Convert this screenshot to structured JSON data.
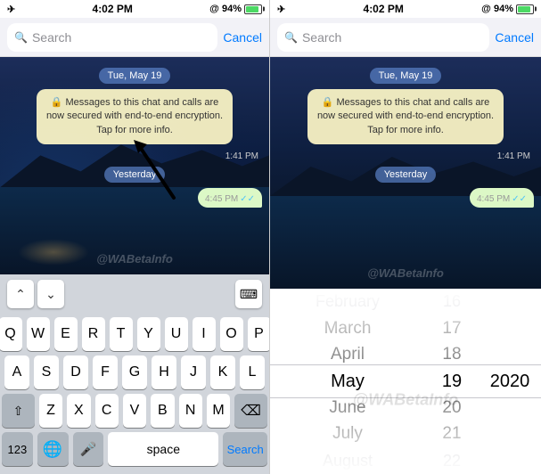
{
  "panels": [
    {
      "id": "left",
      "statusBar": {
        "airplane": "✈",
        "time": "4:02 PM",
        "signal": "@ 94%"
      },
      "searchBar": {
        "placeholder": "Search",
        "cancelLabel": "Cancel"
      },
      "chat": {
        "dateBadge": "Tue, May 19",
        "systemMsg": "Messages to this chat and calls are now secured with end-to-end encryption. Tap for more info.",
        "lockIcon": "🔒",
        "time1": "1:41 PM",
        "yesterdayBadge": "Yesterday",
        "time2": "4:45 PM"
      },
      "keyboard": {
        "row1": [
          "Q",
          "W",
          "E",
          "R",
          "T",
          "Y",
          "U",
          "I",
          "O",
          "P"
        ],
        "row2": [
          "A",
          "S",
          "D",
          "F",
          "G",
          "H",
          "J",
          "K",
          "L"
        ],
        "row3": [
          "Z",
          "X",
          "C",
          "V",
          "B",
          "N",
          "M"
        ],
        "spaceLabel": "space",
        "searchLabel": "Search",
        "numLabel": "123",
        "deleteLabel": "⌫",
        "shiftLabel": "⇧",
        "globeLabel": "🌐",
        "micLabel": "🎤"
      }
    },
    {
      "id": "right",
      "statusBar": {
        "airplane": "✈",
        "time": "4:02 PM",
        "signal": "@ 94%"
      },
      "searchBar": {
        "placeholder": "Search",
        "cancelLabel": "Cancel"
      },
      "chat": {
        "dateBadge": "Tue, May 19",
        "systemMsg": "Messages to this chat and calls are now secured with end-to-end encryption. Tap for more info.",
        "lockIcon": "🔒",
        "time1": "1:41 PM",
        "yesterdayBadge": "Yesterday",
        "time2": "4:45 PM"
      },
      "datePicker": {
        "months": [
          "February",
          "March",
          "April",
          "May",
          "June",
          "July",
          "August"
        ],
        "days": [
          "16",
          "17",
          "18",
          "19",
          "20",
          "21",
          "22"
        ],
        "years": [
          "",
          "",
          "",
          "2020",
          "",
          "",
          ""
        ],
        "selectedMonth": "May",
        "selectedDay": "19",
        "selectedYear": "2020"
      }
    }
  ],
  "watermark": "@WABetaInfo",
  "watermark2": "@WABetaInfo"
}
